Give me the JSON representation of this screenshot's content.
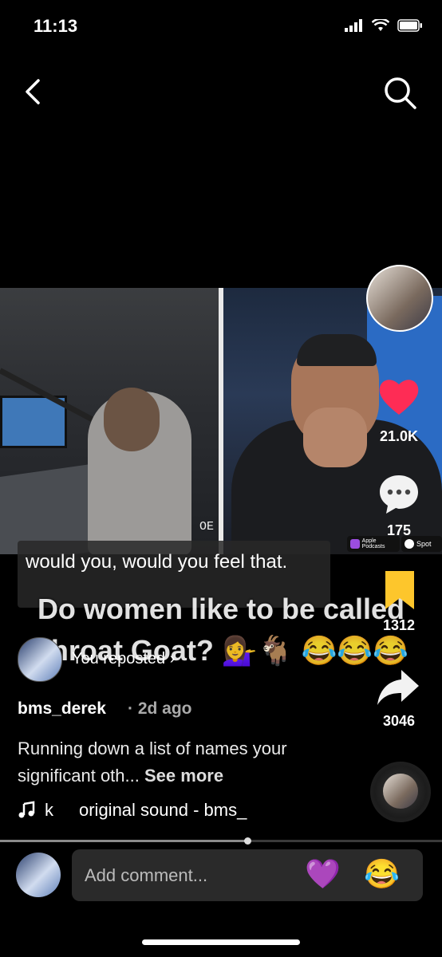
{
  "status_bar": {
    "time": "11:13"
  },
  "video": {
    "caption": "would you, would you feel that.",
    "overlay_text": "Do women like to be called Throat Goat? 💁‍♀️🐐 😂😂😂",
    "oe_label": "OE",
    "apple_badge": "Apple Podcasts",
    "spotify_badge": "Spot"
  },
  "repost": {
    "label": "You reposted"
  },
  "post": {
    "author": "bms_derek",
    "time": "· 2d ago",
    "description": "Running down a list of names your significant oth...",
    "see_more": "See more",
    "sound_prefix": "k",
    "sound": "original sound - bms_"
  },
  "rail": {
    "likes": "21.0K",
    "comments": "175",
    "saves": "1312",
    "shares": "3046"
  },
  "comment_bar": {
    "placeholder": "Add comment...",
    "emoji_1": "💜",
    "emoji_2": "😂"
  },
  "colors": {
    "like": "#fe2c55",
    "bookmark": "#fdc62c"
  }
}
